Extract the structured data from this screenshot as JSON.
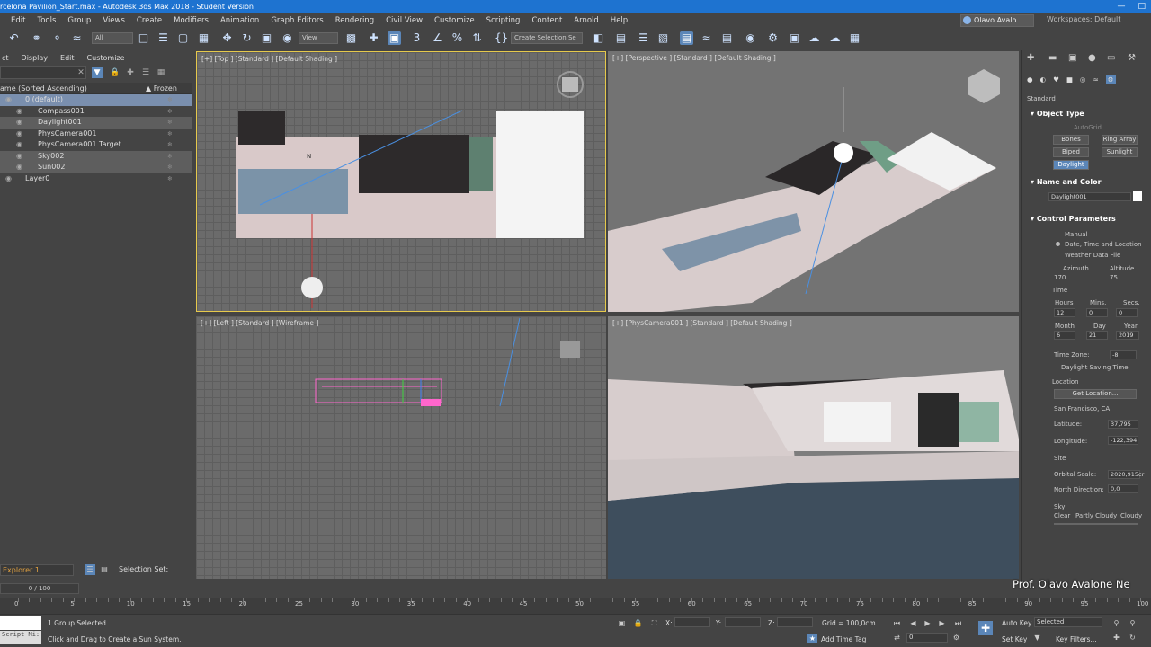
{
  "window": {
    "title": "rcelona Pavilion_Start.max - Autodesk 3ds Max 2018 - Student Version"
  },
  "menu": {
    "items": [
      "Edit",
      "Tools",
      "Group",
      "Views",
      "Create",
      "Modifiers",
      "Animation",
      "Graph Editors",
      "Rendering",
      "Civil View",
      "Customize",
      "Scripting",
      "Content",
      "Arnold",
      "Help"
    ],
    "user": "Olavo Avalo...",
    "workspaces_label": "Workspaces:",
    "workspaces_value": "Default"
  },
  "toolbar": {
    "selection_filter": "All",
    "ref_coord": "View",
    "named_selection": "Create Selection Se"
  },
  "scene_explorer": {
    "menu": [
      "ct",
      "Display",
      "Edit",
      "Customize"
    ],
    "column_name": "ame (Sorted Ascending)",
    "column_frozen": "Frozen",
    "items": [
      {
        "label": "0 (default)",
        "level": 0,
        "state": "highlight"
      },
      {
        "label": "Compass001",
        "level": 1,
        "state": "normal"
      },
      {
        "label": "Daylight001",
        "level": 1,
        "state": "sel"
      },
      {
        "label": "PhysCamera001",
        "level": 1,
        "state": "normal"
      },
      {
        "label": "PhysCamera001.Target",
        "level": 1,
        "state": "normal"
      },
      {
        "label": "Sky002",
        "level": 1,
        "state": "sel"
      },
      {
        "label": "Sun002",
        "level": 1,
        "state": "sel"
      },
      {
        "label": "Layer0",
        "level": 0,
        "state": "normal"
      }
    ],
    "explorer_dropdown": "Explorer 1",
    "selection_set_label": "Selection Set:"
  },
  "viewports": {
    "top": {
      "label": "[+] [Top ] [Standard ] [Default Shading ]"
    },
    "perspective": {
      "label": "[+] [Perspective ] [Standard ] [Default Shading ]"
    },
    "left": {
      "label": "[+] [Left ] [Standard ] [Wireframe ]"
    },
    "camera": {
      "label": "[+] [PhysCamera001 ] [Standard ] [Default Shading ]"
    }
  },
  "command_panel": {
    "category": "Standard",
    "object_type_title": "Object Type",
    "autogrid": "AutoGrid",
    "buttons": [
      "Bones",
      "Ring Array",
      "Biped",
      "Sunlight",
      "Daylight"
    ],
    "name_color_title": "Name and Color",
    "name_value": "Daylight001",
    "control_params_title": "Control Parameters",
    "manual": "Manual",
    "date_time_location": "Date, Time and Location",
    "weather_data_file": "Weather Data File",
    "azimuth_label": "Azimuth",
    "altitude_label": "Altitude",
    "azimuth_value": "170",
    "altitude_value": "75",
    "time_title": "Time",
    "hours_label": "Hours",
    "mins_label": "Mins.",
    "secs_label": "Secs.",
    "hours_value": "12",
    "mins_value": "0",
    "secs_value": "0",
    "month_label": "Month",
    "day_label": "Day",
    "year_label": "Year",
    "month_value": "6",
    "day_value": "21",
    "year_value": "2019",
    "time_zone_label": "Time Zone:",
    "time_zone_value": "-8",
    "daylight_saving": "Daylight Saving Time",
    "location_title": "Location",
    "get_location": "Get Location...",
    "location_name": "San Francisco, CA",
    "latitude_label": "Latitude:",
    "latitude_value": "37,795",
    "longitude_label": "Longitude:",
    "longitude_value": "-122,394",
    "site_title": "Site",
    "orbital_scale_label": "Orbital Scale:",
    "orbital_scale_value": "2020,915cr",
    "north_direction_label": "North Direction:",
    "north_direction_value": "0,0",
    "sky_title": "Sky",
    "sky_options": [
      "Clear",
      "Partly Cloudy",
      "Cloudy"
    ]
  },
  "timeline": {
    "frame_counter": "0 / 100",
    "ticks": [
      "0",
      "5",
      "10",
      "15",
      "20",
      "25",
      "30",
      "35",
      "40",
      "45",
      "50",
      "55",
      "60",
      "65",
      "70",
      "75",
      "80",
      "85",
      "90",
      "95",
      "100"
    ]
  },
  "status": {
    "script_label": "",
    "script_mini": "Script Mi:",
    "selected_text": "1 Group Selected",
    "prompt_text": "Click and Drag to Create a Sun System.",
    "x_label": "X:",
    "y_label": "Y:",
    "z_label": "Z:",
    "grid_text": "Grid = 100,0cm",
    "add_time_tag": "Add Time Tag",
    "auto_key": "Auto Key",
    "set_key": "Set Key",
    "selected_dropdown": "Selected",
    "key_filters": "Key Filters...",
    "current_frame": "0"
  },
  "watermark": "Prof. Olavo Avalone Ne"
}
